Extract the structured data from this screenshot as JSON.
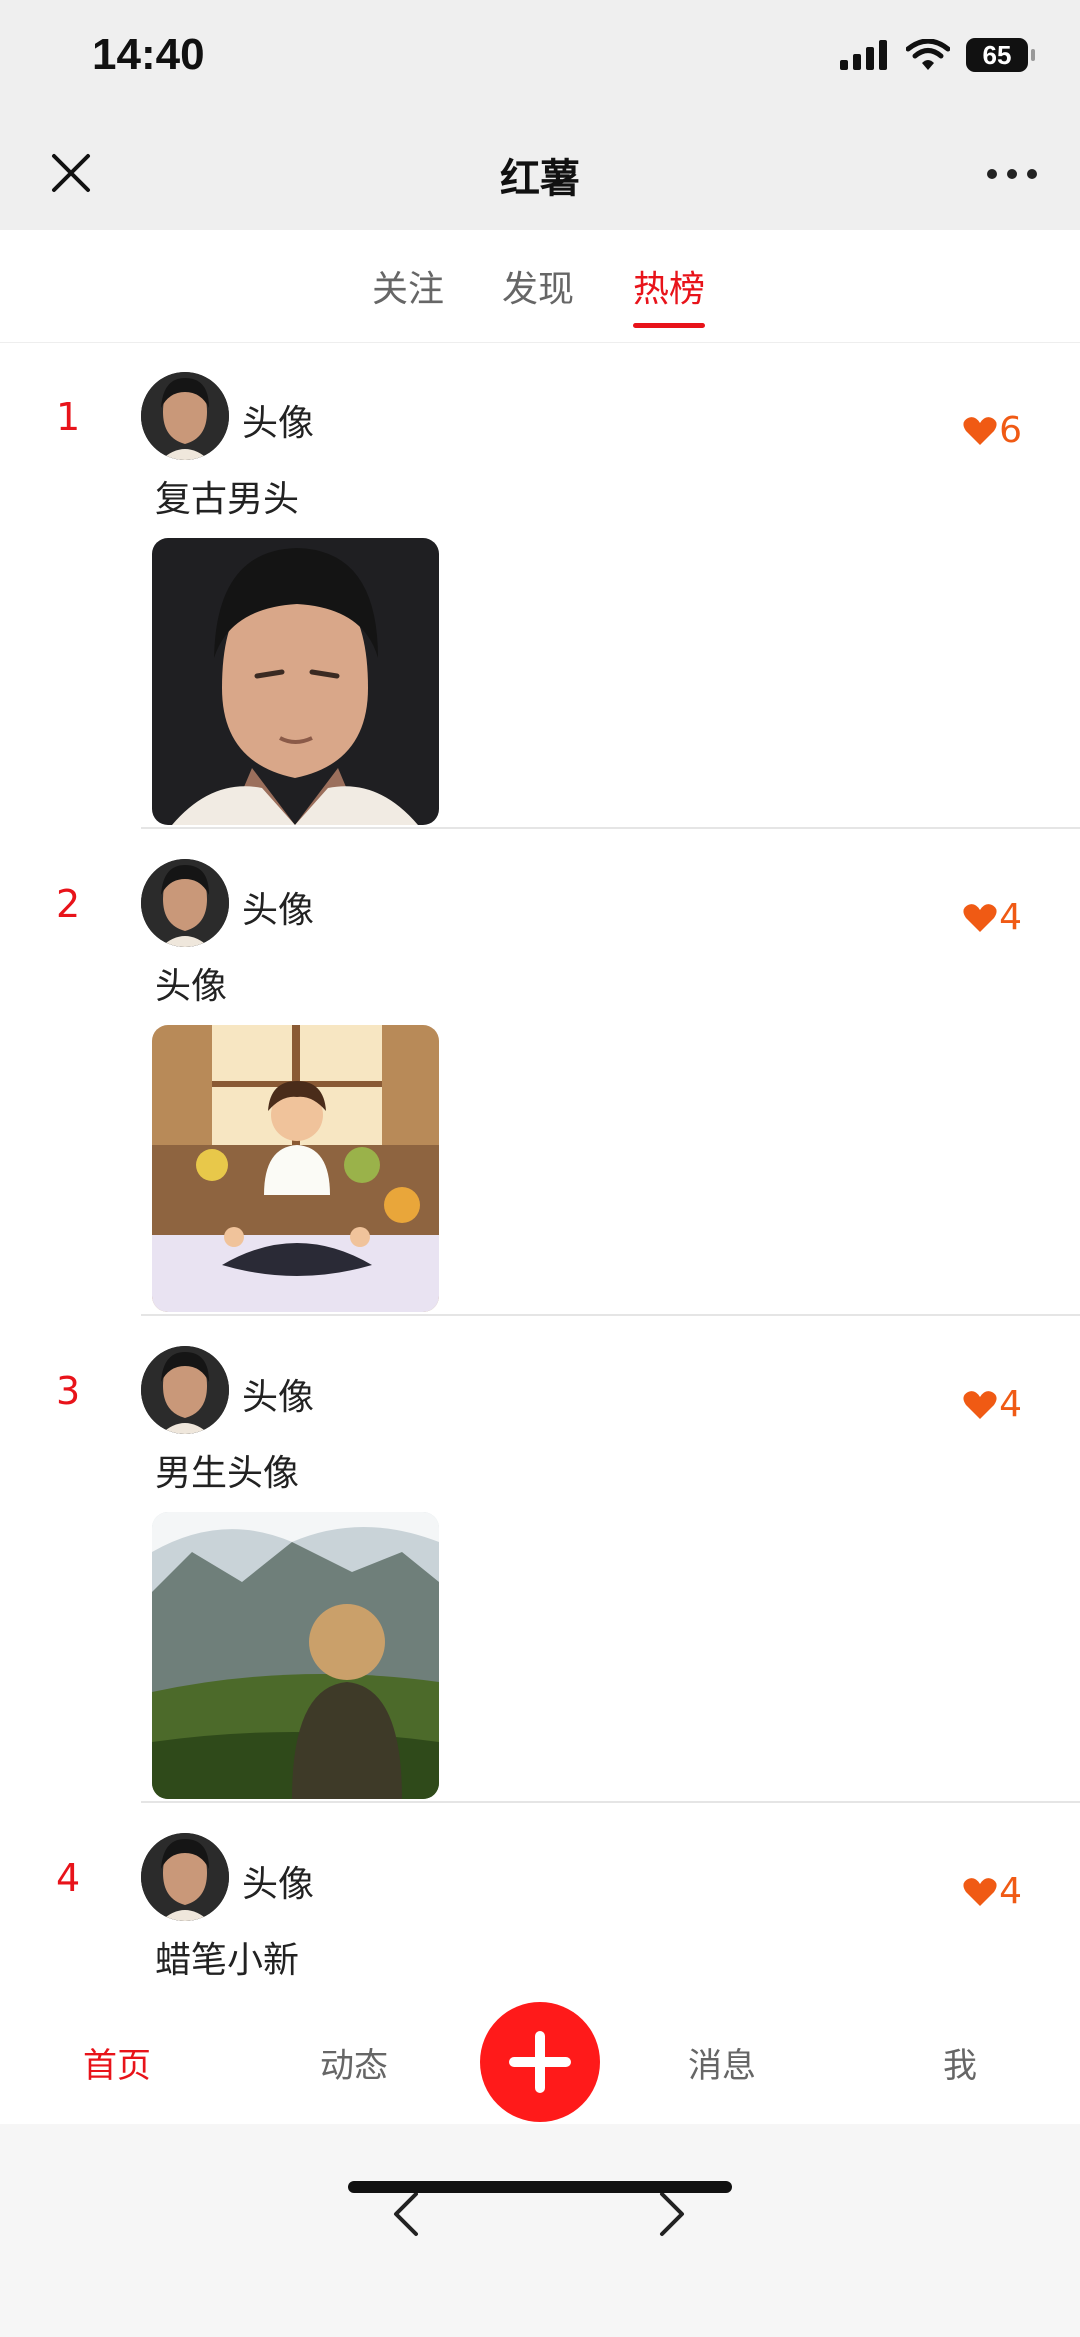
{
  "status_bar": {
    "time": "14:40",
    "battery": "65"
  },
  "nav": {
    "title": "红薯"
  },
  "tabs": [
    {
      "label": "关注",
      "active": false
    },
    {
      "label": "发现",
      "active": false
    },
    {
      "label": "热榜",
      "active": true
    }
  ],
  "feed": [
    {
      "rank": "1",
      "author": "头像",
      "title": "复古男头",
      "likes": "6"
    },
    {
      "rank": "2",
      "author": "头像",
      "title": "头像",
      "likes": "4"
    },
    {
      "rank": "3",
      "author": "头像",
      "title": "男生头像",
      "likes": "4"
    },
    {
      "rank": "4",
      "author": "头像",
      "title": "蜡笔小新",
      "likes": "4"
    }
  ],
  "tabbar": {
    "home": "首页",
    "activity": "动态",
    "messages": "消息",
    "me": "我"
  },
  "colors": {
    "accent": "#e8131a",
    "like": "#f05a14",
    "plus": "#ff1a1a"
  }
}
